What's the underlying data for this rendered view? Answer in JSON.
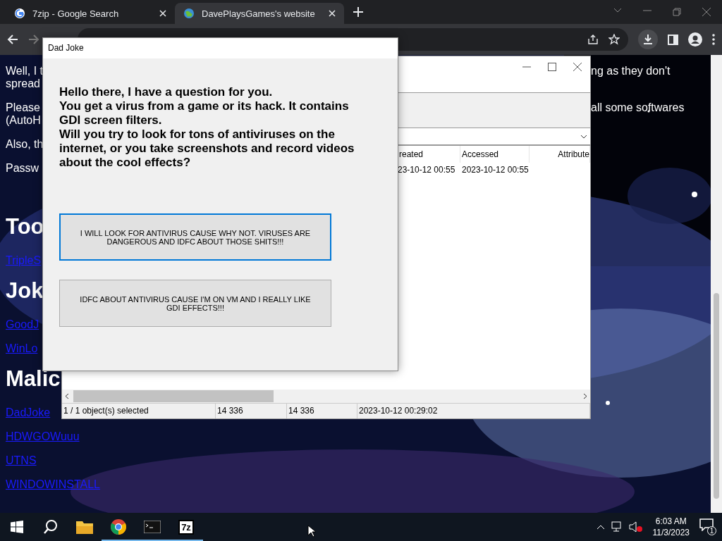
{
  "browser": {
    "tabs": [
      {
        "title": "7zip - Google Search",
        "selected": false
      },
      {
        "title": "DavePlaysGames's website",
        "selected": true
      }
    ]
  },
  "page": {
    "paragraphs": [
      {
        "lines": [
          "Well, I t",
          "spread"
        ],
        "right": "ng as they don't"
      },
      {
        "lines": [
          "Please",
          "(AutoH"
        ],
        "right": "all some softwares"
      },
      {
        "lines": [
          "Also, th"
        ]
      },
      {
        "lines": [
          "Passw"
        ]
      }
    ],
    "sections": [
      {
        "heading": "Too",
        "links": [
          "TripleS"
        ]
      },
      {
        "heading": "Jok",
        "links": [
          "GoodJ",
          "WinLo"
        ]
      },
      {
        "heading": "Malic",
        "links": [
          "DadJoke",
          "HDWGOWuuu",
          "UTNS",
          "WINDOWINSTALL"
        ]
      }
    ]
  },
  "archive_window": {
    "columns": [
      "reated",
      "Accessed",
      "Attribute"
    ],
    "row": [
      "23-10-12 00:55",
      "2023-10-12 00:55"
    ],
    "status": [
      "1 / 1 object(s) selected",
      "14 336",
      "14 336",
      "2023-10-12 00:29:02"
    ]
  },
  "dialog": {
    "title": "Dad Joke",
    "question": [
      "Hello there, I have a question for you.",
      "You get a virus from a game or its hack. It contains GDI screen filters.",
      "Will you try to look for tons of antiviruses on the internet, or you take screenshots and record videos about the cool effects?"
    ],
    "buttons": [
      {
        "label": "I WILL LOOK FOR ANTIVIRUS CAUSE WHY NOT. VIRUSES ARE DANGEROUS AND IDFC ABOUT THOSE SHITS!!!",
        "focused": true
      },
      {
        "label": "IDFC ABOUT ANTIVIRUS CAUSE I'M ON VM AND I REALLY LIKE GDI EFFECTS!!!",
        "focused": false
      }
    ]
  },
  "taskbar": {
    "apps": [
      {
        "kind": "search",
        "running": false
      },
      {
        "kind": "folder",
        "running": false
      },
      {
        "kind": "chrome",
        "running": true
      },
      {
        "kind": "terminal",
        "running": true
      },
      {
        "kind": "archiver",
        "label": "7z",
        "running": true
      }
    ],
    "time": "6:03 AM",
    "date": "11/3/2023",
    "notifications": "1"
  }
}
